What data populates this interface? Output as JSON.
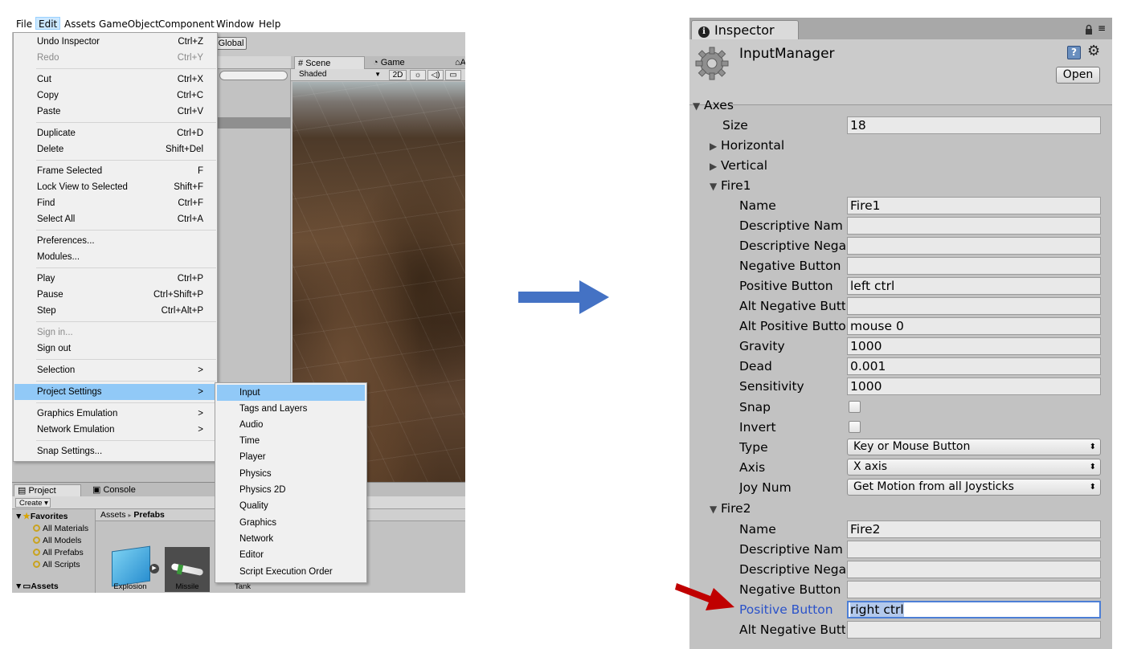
{
  "menubar": [
    "File",
    "Edit",
    "Assets",
    "GameObject",
    "Component",
    "Window",
    "Help"
  ],
  "editor": {
    "global_label": "Global",
    "scene_tab": "Scene",
    "game_tab": "Game",
    "asset_tab": "As",
    "shading_mode": "Shaded",
    "mode_2d": "2D",
    "project_tab": "Project",
    "console_tab": "Console",
    "create_label": "Create",
    "favorites_label": "Favorites",
    "favorites": [
      "All Materials",
      "All Models",
      "All Prefabs",
      "All Scripts"
    ],
    "assets_tree_label": "Assets",
    "breadcrumb_root": "Assets",
    "breadcrumb_sep": "▸",
    "breadcrumb_current": "Prefabs",
    "asset_tiles": [
      "Explosion",
      "Missile",
      "Tank"
    ]
  },
  "edit_menu": {
    "items": [
      {
        "label": "Undo Inspector",
        "shortcut": "Ctrl+Z"
      },
      {
        "label": "Redo",
        "shortcut": "Ctrl+Y"
      },
      {
        "label": "Cut",
        "shortcut": "Ctrl+X"
      },
      {
        "label": "Copy",
        "shortcut": "Ctrl+C"
      },
      {
        "label": "Paste",
        "shortcut": "Ctrl+V"
      },
      {
        "label": "Duplicate",
        "shortcut": "Ctrl+D"
      },
      {
        "label": "Delete",
        "shortcut": "Shift+Del"
      },
      {
        "label": "Frame Selected",
        "shortcut": "F"
      },
      {
        "label": "Lock View to Selected",
        "shortcut": "Shift+F"
      },
      {
        "label": "Find",
        "shortcut": "Ctrl+F"
      },
      {
        "label": "Select All",
        "shortcut": "Ctrl+A"
      },
      {
        "label": "Preferences...",
        "shortcut": ""
      },
      {
        "label": "Modules...",
        "shortcut": ""
      },
      {
        "label": "Play",
        "shortcut": "Ctrl+P"
      },
      {
        "label": "Pause",
        "shortcut": "Ctrl+Shift+P"
      },
      {
        "label": "Step",
        "shortcut": "Ctrl+Alt+P"
      },
      {
        "label": "Sign in...",
        "shortcut": ""
      },
      {
        "label": "Sign out",
        "shortcut": ""
      },
      {
        "label": "Selection",
        "shortcut": ">"
      },
      {
        "label": "Project Settings",
        "shortcut": ">"
      },
      {
        "label": "Graphics Emulation",
        "shortcut": ">"
      },
      {
        "label": "Network Emulation",
        "shortcut": ">"
      },
      {
        "label": "Snap Settings...",
        "shortcut": ""
      }
    ]
  },
  "project_settings_submenu": [
    "Input",
    "Tags and Layers",
    "Audio",
    "Time",
    "Player",
    "Physics",
    "Physics 2D",
    "Quality",
    "Graphics",
    "Network",
    "Editor",
    "Script Execution Order"
  ],
  "inspector": {
    "tab_label": "Inspector",
    "asset_name": "InputManager",
    "open_button": "Open",
    "axes_label": "Axes",
    "size_label": "Size",
    "size_value": "18",
    "horizontal_label": "Horizontal",
    "vertical_label": "Vertical",
    "fire1": {
      "label": "Fire1",
      "name_label": "Name",
      "name_value": "Fire1",
      "desc_name_label": "Descriptive Nam",
      "desc_name_value": "",
      "desc_neg_label": "Descriptive Nega",
      "desc_neg_value": "",
      "neg_button_label": "Negative Button",
      "neg_button_value": "",
      "pos_button_label": "Positive Button",
      "pos_button_value": "left ctrl",
      "alt_neg_label": "Alt Negative Butt",
      "alt_neg_value": "",
      "alt_pos_label": "Alt Positive Butto",
      "alt_pos_value": "mouse 0",
      "gravity_label": "Gravity",
      "gravity_value": "1000",
      "dead_label": "Dead",
      "dead_value": "0.001",
      "sensitivity_label": "Sensitivity",
      "sensitivity_value": "1000",
      "snap_label": "Snap",
      "invert_label": "Invert",
      "type_label": "Type",
      "type_value": "Key or Mouse Button",
      "axis_label": "Axis",
      "axis_value": "X axis",
      "joy_label": "Joy Num",
      "joy_value": "Get Motion from all Joysticks"
    },
    "fire2": {
      "label": "Fire2",
      "name_label": "Name",
      "name_value": "Fire2",
      "desc_name_label": "Descriptive Nam",
      "desc_name_value": "",
      "desc_neg_label": "Descriptive Nega",
      "desc_neg_value": "",
      "neg_button_label": "Negative Button",
      "neg_button_value": "",
      "pos_button_label": "Positive Button",
      "pos_button_value": "right ctrl",
      "alt_neg_label": "Alt Negative Butt"
    }
  },
  "colors": {
    "menu_highlight": "#91c9f7",
    "arrow_blue": "#4472c4",
    "arrow_red": "#c00000",
    "focus_label": "#2a52c9"
  }
}
